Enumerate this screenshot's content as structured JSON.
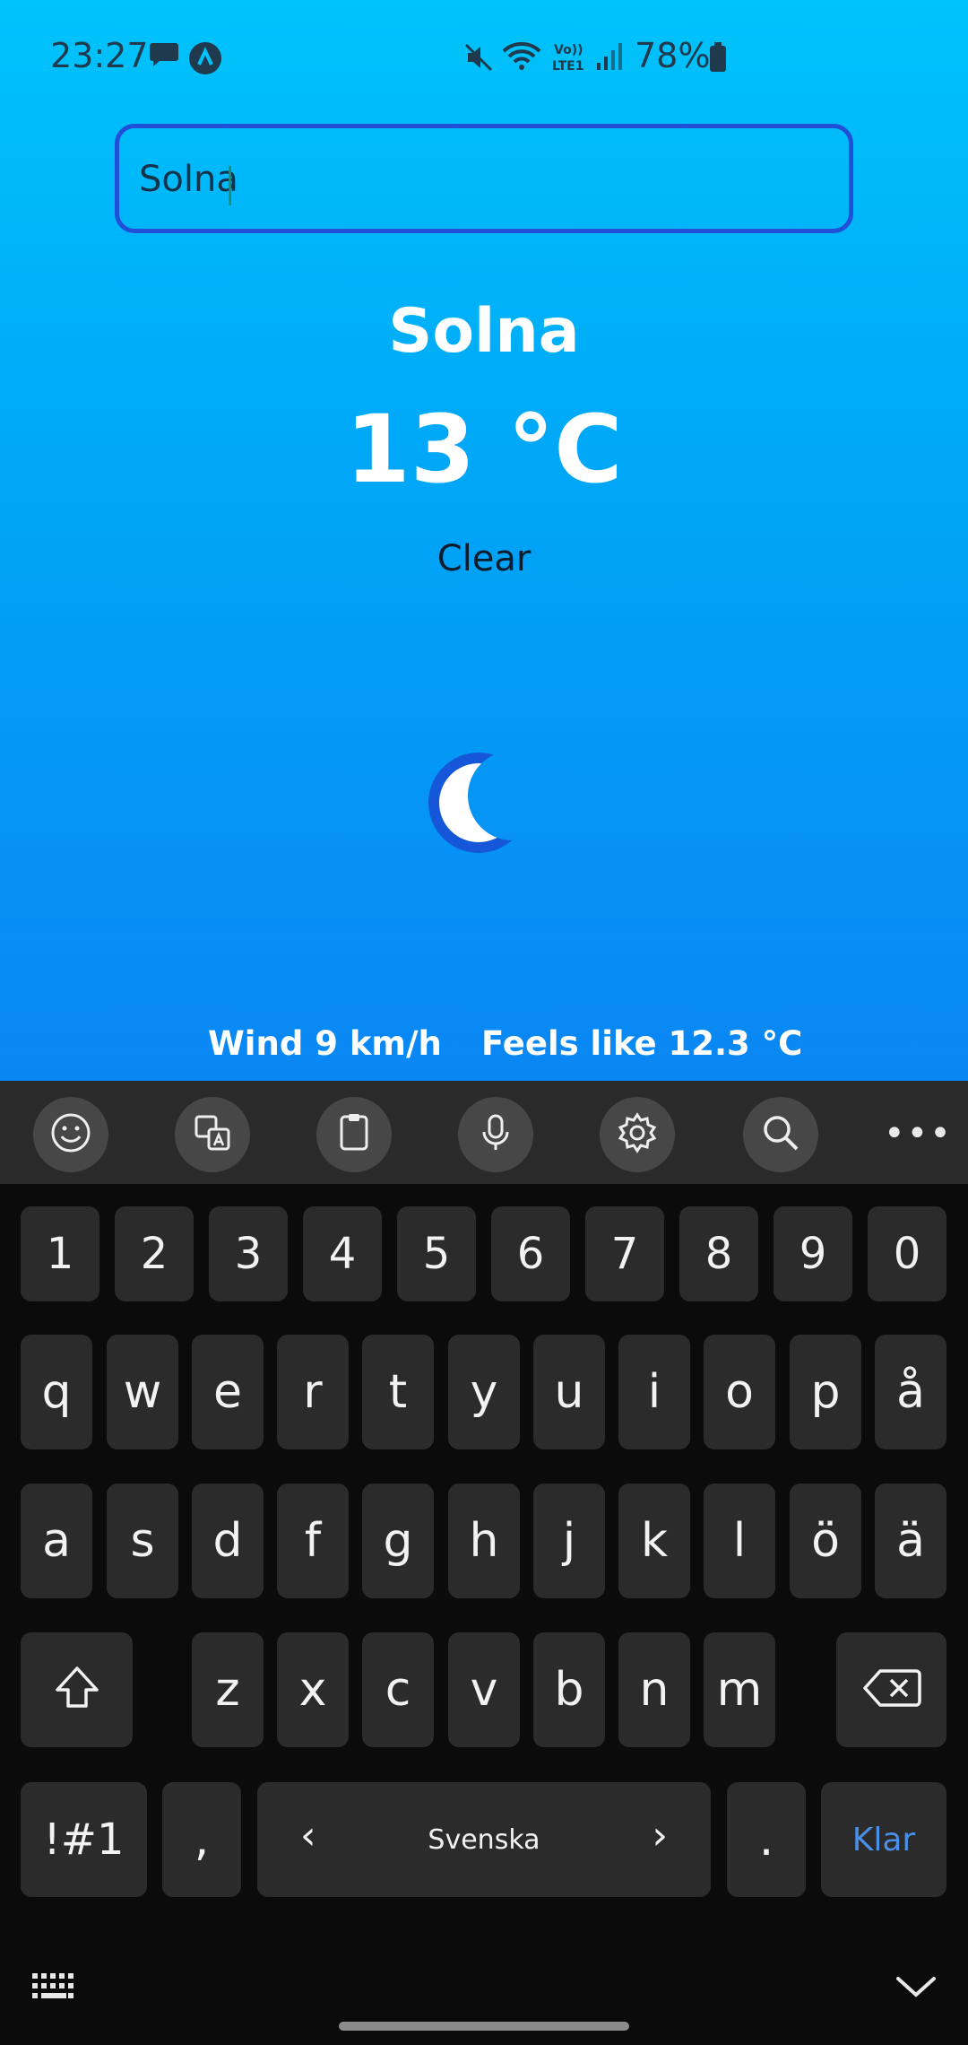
{
  "status_bar": {
    "time": "23:27",
    "battery": "78%",
    "icons": [
      "chat-icon",
      "app-icon",
      "mute-icon",
      "wifi-icon",
      "volte-icon",
      "signal-icon",
      "battery-icon"
    ]
  },
  "search": {
    "value": "Solna",
    "placeholder": ""
  },
  "weather": {
    "city": "Solna",
    "temperature": "13 °C",
    "condition": "Clear",
    "icon": "moon-icon",
    "wind": "Wind 9 km/h",
    "feels_like": "Feels like 12.3 °C"
  },
  "keyboard": {
    "toolbar": [
      "emoji-icon",
      "translate-icon",
      "clipboard-icon",
      "mic-icon",
      "settings-icon",
      "search-icon",
      "more-icon"
    ],
    "more_label": "•••",
    "number_row": [
      "1",
      "2",
      "3",
      "4",
      "5",
      "6",
      "7",
      "8",
      "9",
      "0"
    ],
    "row1": [
      "q",
      "w",
      "e",
      "r",
      "t",
      "y",
      "u",
      "i",
      "o",
      "p",
      "å"
    ],
    "row2": [
      "a",
      "s",
      "d",
      "f",
      "g",
      "h",
      "j",
      "k",
      "l",
      "ö",
      "ä"
    ],
    "row3": [
      "z",
      "x",
      "c",
      "v",
      "b",
      "n",
      "m"
    ],
    "symbols_label": "!#1",
    "comma": ",",
    "space_label": "Svenska",
    "space_left": "‹",
    "space_right": "›",
    "period": ".",
    "done_label": "Klar"
  },
  "colors": {
    "app_top": "#00c3fb",
    "app_bottom": "#0a86f3",
    "input_border": "#2050d8",
    "keyboard_bg": "#0b0b0b",
    "key_bg": "#2b2b2b",
    "done_color": "#4a8fe7"
  }
}
